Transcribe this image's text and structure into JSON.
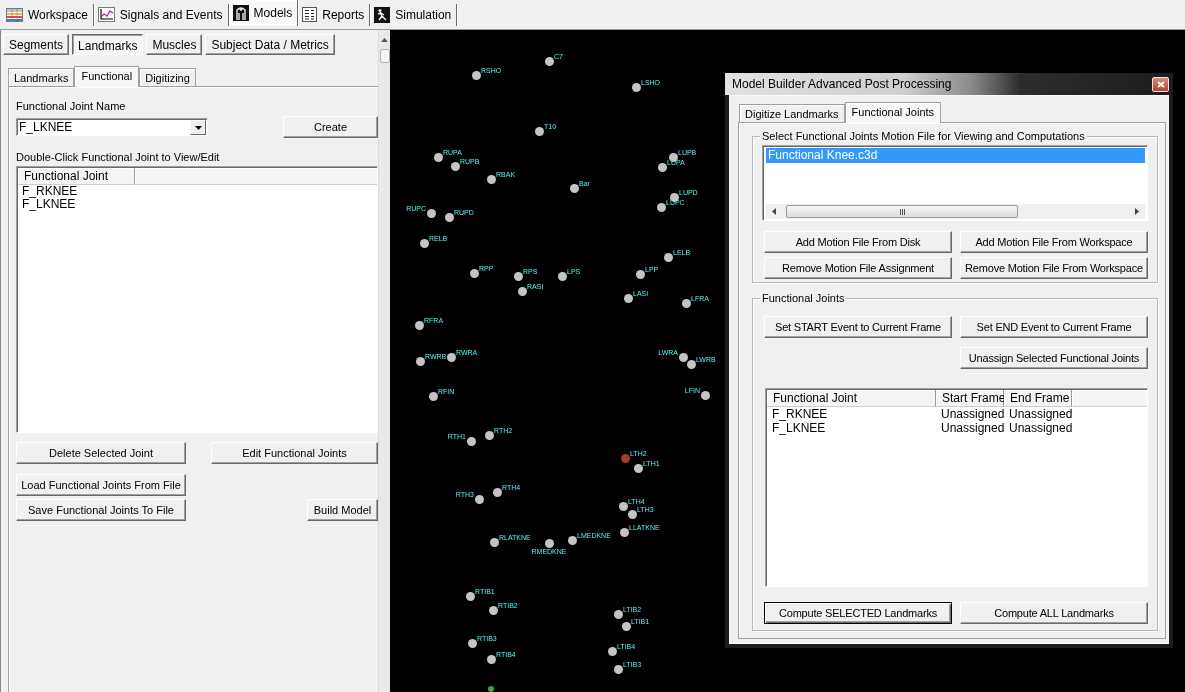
{
  "app_tabs": [
    {
      "label": "Workspace",
      "selected": false
    },
    {
      "label": "Signals and Events",
      "selected": false
    },
    {
      "label": "Models",
      "selected": true
    },
    {
      "label": "Reports",
      "selected": false
    },
    {
      "label": "Simulation",
      "selected": false
    }
  ],
  "left_panel": {
    "tabs": [
      {
        "label": "Segments",
        "selected": false
      },
      {
        "label": "Landmarks",
        "selected": true
      },
      {
        "label": "Muscles",
        "selected": false
      },
      {
        "label": "Subject Data / Metrics",
        "selected": false
      }
    ],
    "subtabs": [
      {
        "label": "Landmarks",
        "selected": false
      },
      {
        "label": "Functional",
        "selected": true
      },
      {
        "label": "Digitizing",
        "selected": false
      }
    ],
    "joint_name_label": "Functional Joint Name",
    "joint_name_combo": {
      "value": "F_LKNEE"
    },
    "create_button": "Create",
    "list_hint": "Double-Click Functional Joint to View/Edit",
    "joint_list": {
      "columns": [
        "Functional Joint"
      ],
      "rows": [
        {
          "name": "F_RKNEE",
          "selected": false
        },
        {
          "name": "F_LKNEE",
          "selected": false
        }
      ]
    },
    "delete_button": "Delete Selected Joint",
    "edit_button": "Edit Functional Joints",
    "load_button": "Load Functional Joints From File",
    "save_button": "Save Functional Joints To File",
    "build_button": "Build Model"
  },
  "viewport": {
    "markers": [
      {
        "label": "C7",
        "color": "#c4c4c4"
      },
      {
        "label": "RSHO",
        "color": "#c4c4c4"
      },
      {
        "label": "LSHO",
        "color": "#c4c4c4"
      },
      {
        "label": "T10",
        "color": "#c4c4c4"
      },
      {
        "label": "RUPA",
        "color": "#c4c4c4"
      },
      {
        "label": "RUPB",
        "color": "#c4c4c4"
      },
      {
        "label": "RBAK",
        "color": "#c4c4c4"
      },
      {
        "label": "Bar",
        "color": "#c4c4c4"
      },
      {
        "label": "LUPB",
        "color": "#c4c4c4"
      },
      {
        "label": "LUPA",
        "color": "#c4c4c4"
      },
      {
        "label": "LUPD",
        "color": "#c4c4c4"
      },
      {
        "label": "LUPC",
        "color": "#c4c4c4"
      },
      {
        "label": "RUPC",
        "color": "#c4c4c4"
      },
      {
        "label": "RUPD",
        "color": "#c4c4c4"
      },
      {
        "label": "RELB",
        "color": "#c4c4c4"
      },
      {
        "label": "LELB",
        "color": "#c4c4c4"
      },
      {
        "label": "RPP",
        "color": "#c4c4c4"
      },
      {
        "label": "RPS",
        "color": "#c4c4c4"
      },
      {
        "label": "LPS",
        "color": "#c4c4c4"
      },
      {
        "label": "LPP",
        "color": "#c4c4c4"
      },
      {
        "label": "RASI",
        "color": "#c4c4c4"
      },
      {
        "label": "LASI",
        "color": "#c4c4c4"
      },
      {
        "label": "LFRA",
        "color": "#c4c4c4"
      },
      {
        "label": "RFRA",
        "color": "#c4c4c4"
      },
      {
        "label": "RWRB",
        "color": "#c4c4c4"
      },
      {
        "label": "RWRA",
        "color": "#c4c4c4"
      },
      {
        "label": "LWRA",
        "color": "#c4c4c4"
      },
      {
        "label": "LWRB",
        "color": "#c4c4c4"
      },
      {
        "label": "RFIN",
        "color": "#c4c4c4"
      },
      {
        "label": "LFIN",
        "color": "#c4c4c4"
      },
      {
        "label": "RTH1",
        "color": "#c4c4c4"
      },
      {
        "label": "RTH2",
        "color": "#c4c4c4"
      },
      {
        "label": "LTH2",
        "color": "#a33a2e"
      },
      {
        "label": "LTH1",
        "color": "#c4c4c4"
      },
      {
        "label": "RTH3",
        "color": "#c4c4c4"
      },
      {
        "label": "RTH4",
        "color": "#c4c4c4"
      },
      {
        "label": "LTH4",
        "color": "#c4c4c4"
      },
      {
        "label": "LTH3",
        "color": "#c4c4c4"
      },
      {
        "label": "LLATKNE",
        "color": "#c4c4c4"
      },
      {
        "label": "RLATKNE",
        "color": "#c4c4c4"
      },
      {
        "label": "RMEDKNE",
        "color": "#c4c4c4"
      },
      {
        "label": "LMEDKNE",
        "color": "#c4c4c4"
      },
      {
        "label": "RTIB1",
        "color": "#c4c4c4"
      },
      {
        "label": "RTIB2",
        "color": "#c4c4c4"
      },
      {
        "label": "LTIB2",
        "color": "#c4c4c4"
      },
      {
        "label": "LTIB1",
        "color": "#c4c4c4"
      },
      {
        "label": "RTIB3",
        "color": "#c4c4c4"
      },
      {
        "label": "RTIB4",
        "color": "#c4c4c4"
      },
      {
        "label": "LTIB4",
        "color": "#c4c4c4"
      },
      {
        "label": "LTIB3",
        "color": "#c4c4c4"
      },
      {
        "color": "#2fae2f"
      }
    ]
  },
  "dialog": {
    "title": "Model Builder Advanced Post Processing",
    "tabs": [
      {
        "label": "Digitize Landmarks",
        "selected": false
      },
      {
        "label": "Functional Joints",
        "selected": true
      }
    ],
    "motion_group": {
      "legend": "Select Functional Joints Motion File for Viewing and Computations",
      "files": [
        {
          "name": "Functional Knee.c3d",
          "selected": true
        }
      ],
      "buttons": [
        "Add Motion File From Disk",
        "Add Motion File From Workspace",
        "Remove Motion File Assignment",
        "Remove Motion File From Workspace"
      ]
    },
    "joints_group": {
      "legend": "Functional Joints",
      "event_buttons": [
        "Set START Event to Current Frame",
        "Set END Event to Current Frame"
      ],
      "unassign_button": "Unassign Selected Functional Joints",
      "table": {
        "columns": [
          "Functional Joint",
          "Start Frame",
          "End Frame"
        ],
        "rows": [
          {
            "cells": [
              "F_RKNEE",
              "Unassigned",
              "Unassigned"
            ],
            "selected": false
          },
          {
            "cells": [
              "F_LKNEE",
              "Unassigned",
              "Unassigned"
            ],
            "selected": false
          }
        ]
      },
      "compute_buttons": [
        {
          "label": "Compute SELECTED Landmarks",
          "default": true
        },
        {
          "label": "Compute ALL Landmarks",
          "default": false
        }
      ]
    }
  }
}
